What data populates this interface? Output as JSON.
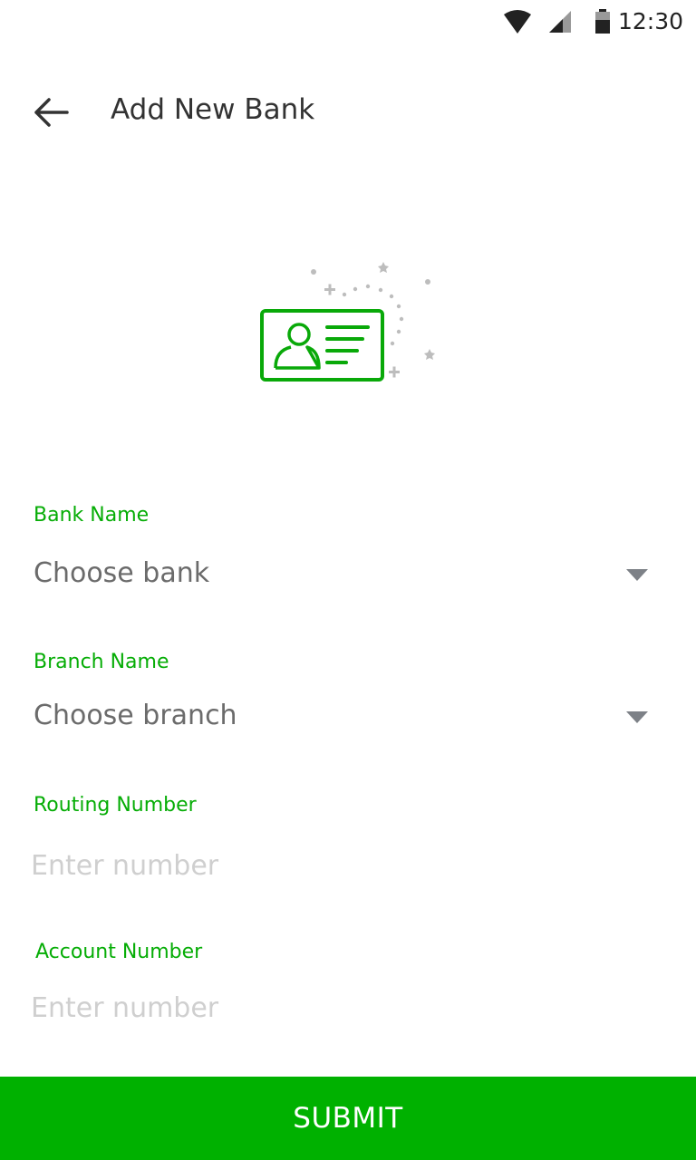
{
  "status_bar": {
    "time": "12:30",
    "icons": [
      "wifi-icon",
      "cell-signal-icon",
      "battery-icon"
    ]
  },
  "app_bar": {
    "back_icon": "arrow-left-icon",
    "title": "Add New Bank"
  },
  "illustration": {
    "icon": "id-card-icon",
    "accent_color": "#09a909",
    "sparkle_color": "#bdbdbd"
  },
  "form": {
    "bank_name": {
      "label": "Bank Name",
      "value": "Choose bank"
    },
    "branch_name": {
      "label": "Branch Name",
      "value": "Choose branch"
    },
    "routing_number": {
      "label": "Routing Number",
      "placeholder": "Enter number"
    },
    "account_number": {
      "label": "Account Number",
      "placeholder": "Enter number"
    }
  },
  "submit": {
    "label": "SUBMIT"
  },
  "colors": {
    "accent": "#00b100",
    "label": "#06ad06",
    "placeholder": "#cfcfcf",
    "select_text": "#6b6b6b"
  }
}
